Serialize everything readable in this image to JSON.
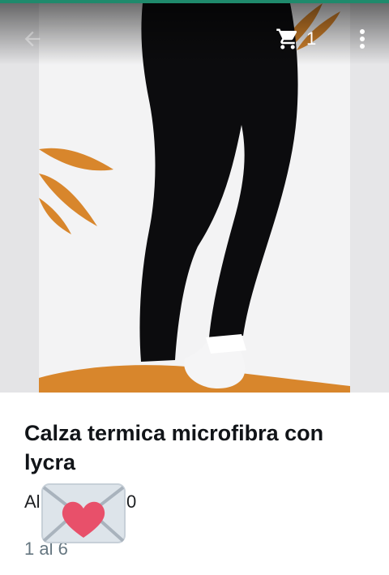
{
  "header": {
    "back_icon": "arrow-back-icon",
    "cart_icon": "shopping-cart-icon",
    "cart_count": "1",
    "more_icon": "more-vert-icon"
  },
  "product": {
    "image_description_icon": "product-photo-black-leggings",
    "title": "Calza termica microfibra con lycra",
    "sender_visible_start": "Al",
    "sender_visible_end": "0",
    "pager": "1 al 6"
  },
  "sticker": {
    "icon": "envelope-heart-sticker-icon"
  },
  "colors": {
    "status_strip": "#1f8a6c",
    "title_text": "#111418",
    "secondary_text": "#667781",
    "leaf_orange": "#d8862c",
    "heart_red": "#e8506a"
  }
}
